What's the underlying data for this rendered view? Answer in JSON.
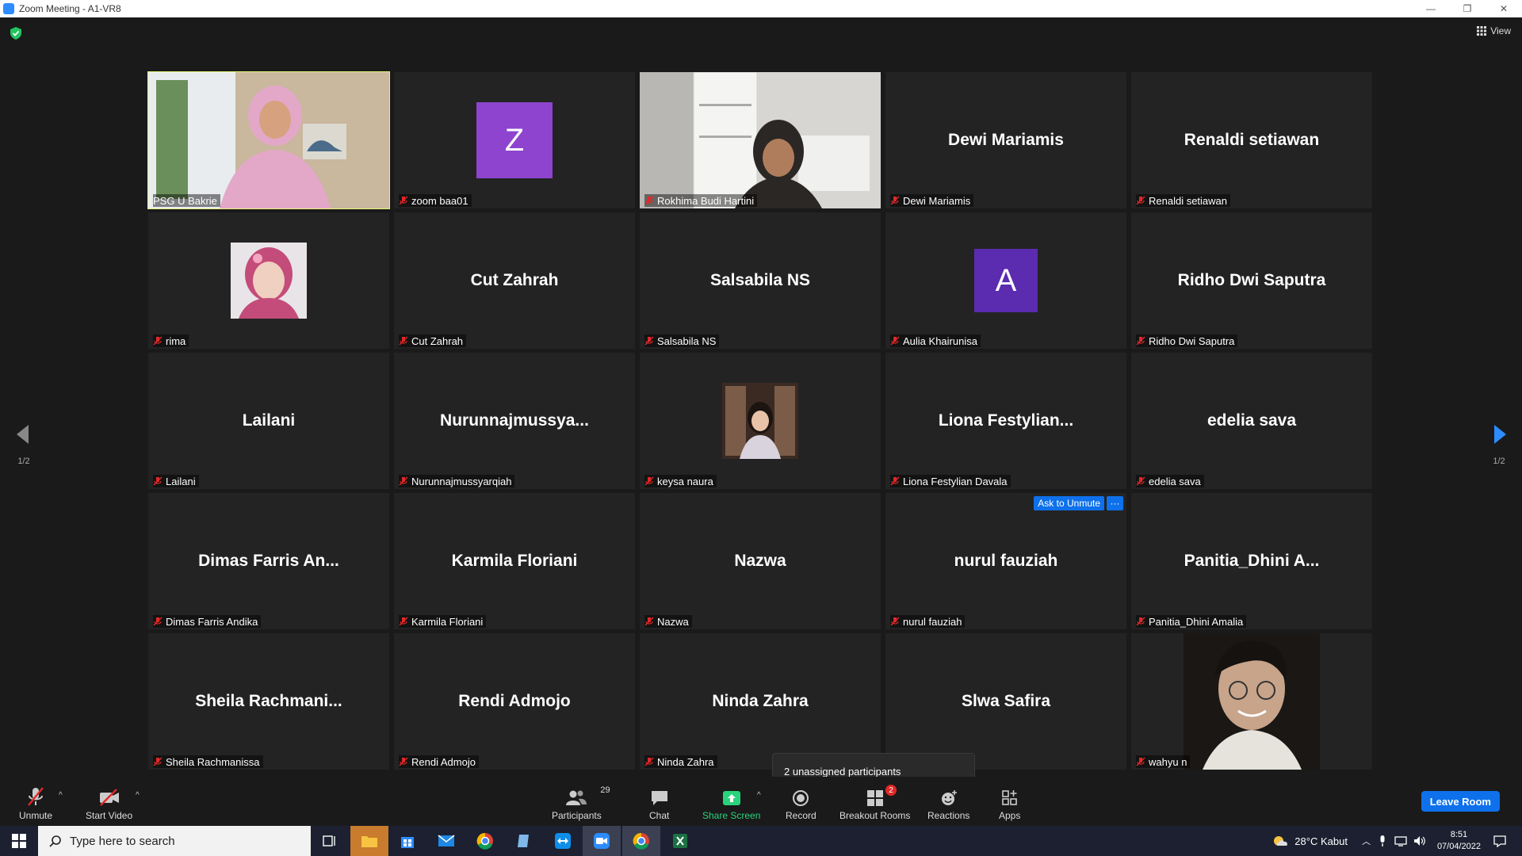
{
  "window": {
    "title": "Zoom Meeting - A1-VR8",
    "controls": [
      "—",
      "❐",
      "✕"
    ]
  },
  "view_button": {
    "label": "View"
  },
  "participants": [
    {
      "display": "",
      "label": "PSG U Bakrie",
      "kind": "video",
      "active": true
    },
    {
      "display": "Z",
      "label": "zoom baa01",
      "kind": "letter",
      "avatar_color": "#8e44ce",
      "muted": true
    },
    {
      "display": "",
      "label": "Rokhima Budi Hartini",
      "kind": "video",
      "muted": true
    },
    {
      "display": "Dewi Mariamis",
      "label": "Dewi Mariamis",
      "kind": "name",
      "muted": true
    },
    {
      "display": "Renaldi setiawan",
      "label": "Renaldi setiawan",
      "kind": "name",
      "muted": true
    },
    {
      "display": "",
      "label": "rima",
      "kind": "photo",
      "muted": true
    },
    {
      "display": "Cut Zahrah",
      "label": "Cut Zahrah",
      "kind": "name",
      "muted": true
    },
    {
      "display": "Salsabila NS",
      "label": "Salsabila NS",
      "kind": "name",
      "muted": true
    },
    {
      "display": "A",
      "label": "Aulia Khairunisa",
      "kind": "letter",
      "avatar_color": "#5b2bb0",
      "muted": true
    },
    {
      "display": "Ridho Dwi Saputra",
      "label": "Ridho Dwi Saputra",
      "kind": "name",
      "muted": true
    },
    {
      "display": "Lailani",
      "label": "Lailani",
      "kind": "name",
      "muted": true
    },
    {
      "display": "Nurunnajmussya...",
      "label": "Nurunnajmussyarqiah",
      "kind": "name",
      "muted": true
    },
    {
      "display": "",
      "label": "keysa naura",
      "kind": "photo",
      "muted": true
    },
    {
      "display": "Liona  Festylian...",
      "label": "Liona Festylian Davala",
      "kind": "name",
      "muted": true
    },
    {
      "display": "edelia sava",
      "label": "edelia sava",
      "kind": "name",
      "muted": true
    },
    {
      "display": "Dimas  Farris  An...",
      "label": "Dimas Farris Andika",
      "kind": "name",
      "muted": true
    },
    {
      "display": "Karmila Floriani",
      "label": "Karmila Floriani",
      "kind": "name",
      "muted": true
    },
    {
      "display": "Nazwa",
      "label": "Nazwa",
      "kind": "name",
      "muted": true
    },
    {
      "display": "nurul fauziah",
      "label": "nurul fauziah",
      "kind": "name",
      "muted": true,
      "hover_actions": {
        "ask_unmute": "Ask to Unmute",
        "more": "···"
      }
    },
    {
      "display": "Panitia_Dhini  A...",
      "label": "Panitia_Dhini Amalia",
      "kind": "name",
      "muted": true
    },
    {
      "display": "Sheila  Rachmani...",
      "label": "Sheila Rachmanissa",
      "kind": "name",
      "muted": true
    },
    {
      "display": "Rendi Admojo",
      "label": "Rendi Admojo",
      "kind": "name",
      "muted": true
    },
    {
      "display": "Ninda Zahra",
      "label": "Ninda Zahra",
      "kind": "name",
      "muted": true
    },
    {
      "display": "Slwa Safira",
      "label": "",
      "kind": "name",
      "muted": false
    },
    {
      "display": "",
      "label": "wahyu n",
      "kind": "video",
      "muted": true
    }
  ],
  "pagination": {
    "left": "1/2",
    "right": "1/2"
  },
  "toolbar": {
    "unmute": "Unmute",
    "start_video": "Start Video",
    "participants": "Participants",
    "participants_count": "29",
    "chat": "Chat",
    "share_screen": "Share Screen",
    "record": "Record",
    "breakout_rooms": "Breakout Rooms",
    "breakout_badge": "2",
    "reactions": "Reactions",
    "apps": "Apps",
    "leave": "Leave Room"
  },
  "popover": {
    "text": "2 unassigned participants"
  },
  "taskbar": {
    "search_placeholder": "Type here to search",
    "weather": "28°C  Kabut",
    "time": "8:51",
    "date": "07/04/2022"
  },
  "colors": {
    "accent_blue": "#0e71eb",
    "share_green": "#2ad37b",
    "active_speaker": "#e8f576",
    "muted_red": "#e02828"
  }
}
